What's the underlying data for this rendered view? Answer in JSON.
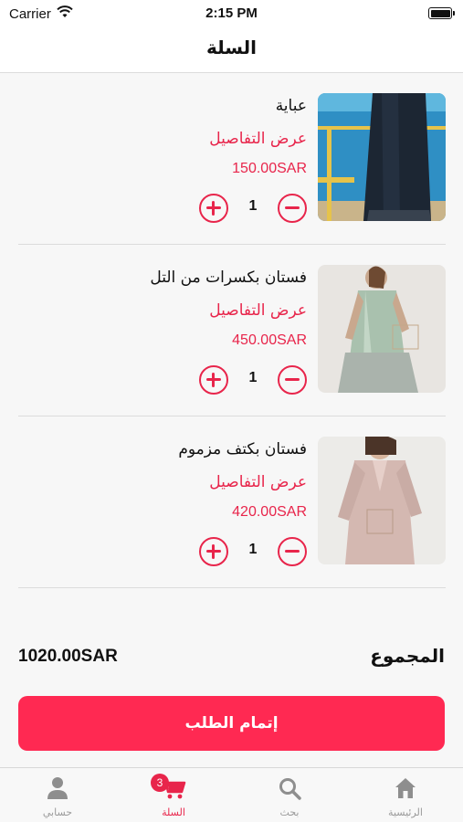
{
  "status_bar": {
    "carrier": "Carrier",
    "time": "2:15 PM"
  },
  "nav": {
    "title": "السلة"
  },
  "cart": {
    "items": [
      {
        "name": "عباية",
        "details_label": "عرض التفاصيل",
        "price": "150.00SAR",
        "quantity": "1"
      },
      {
        "name": "فستان بكسرات من التل",
        "details_label": "عرض التفاصيل",
        "price": "450.00SAR",
        "quantity": "1"
      },
      {
        "name": "فستان بكتف مزموم",
        "details_label": "عرض التفاصيل",
        "price": "420.00SAR",
        "quantity": "1"
      }
    ]
  },
  "summary": {
    "total_label": "المجموع",
    "total_value": "1020.00SAR"
  },
  "checkout": {
    "label": "إتمام الطلب"
  },
  "tabs": [
    {
      "label": "الرئيسية",
      "icon": "home-icon"
    },
    {
      "label": "بحث",
      "icon": "search-icon"
    },
    {
      "label": "السلة",
      "icon": "cart-icon",
      "badge": "3"
    },
    {
      "label": "حسابي",
      "icon": "user-icon"
    }
  ],
  "colors": {
    "accent": "#e8254b",
    "button": "#ff2952",
    "inactive": "#9a9a9a"
  }
}
